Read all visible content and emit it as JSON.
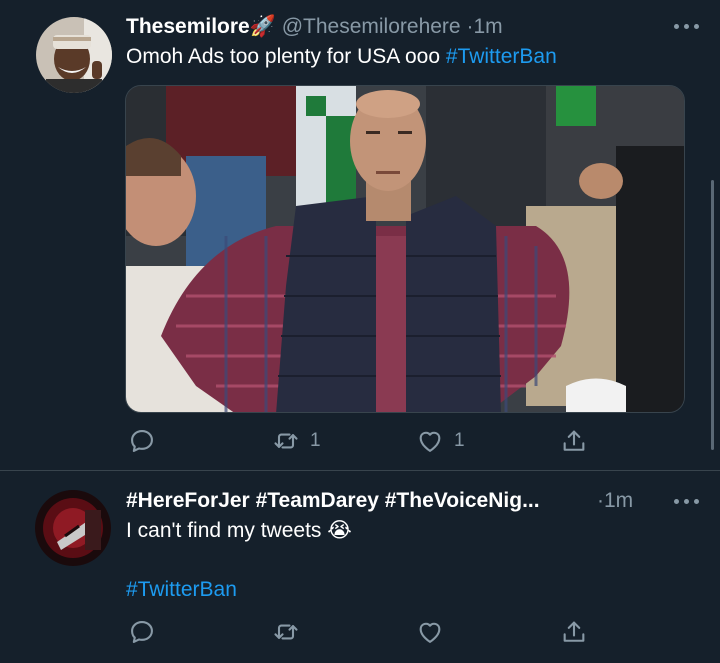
{
  "tweets": [
    {
      "display_name": "Thesemilore",
      "name_emoji": "🚀",
      "handle": "@Thesemilorehere",
      "separator": "·",
      "time": "1m",
      "text": "Omoh Ads too plenty for USA ooo",
      "hashtag": "#TwitterBan",
      "reply_count": "",
      "retweet_count": "1",
      "like_count": "1",
      "has_media": true
    },
    {
      "display_name": "#HereForJer #TeamDarey #TheVoiceNig...",
      "separator": "·",
      "time": "1m",
      "text": "I can't find my tweets",
      "text_emoji": "😭",
      "hashtag": "#TwitterBan",
      "reply_count": "",
      "retweet_count": "",
      "like_count": ""
    }
  ],
  "icons": {
    "reply": "reply-icon",
    "retweet": "retweet-icon",
    "like": "like-icon",
    "share": "share-icon",
    "more": "more-icon"
  },
  "colors": {
    "background": "#15202b",
    "divider": "#38444d",
    "muted": "#8899a6",
    "accent": "#1d9bf0"
  }
}
